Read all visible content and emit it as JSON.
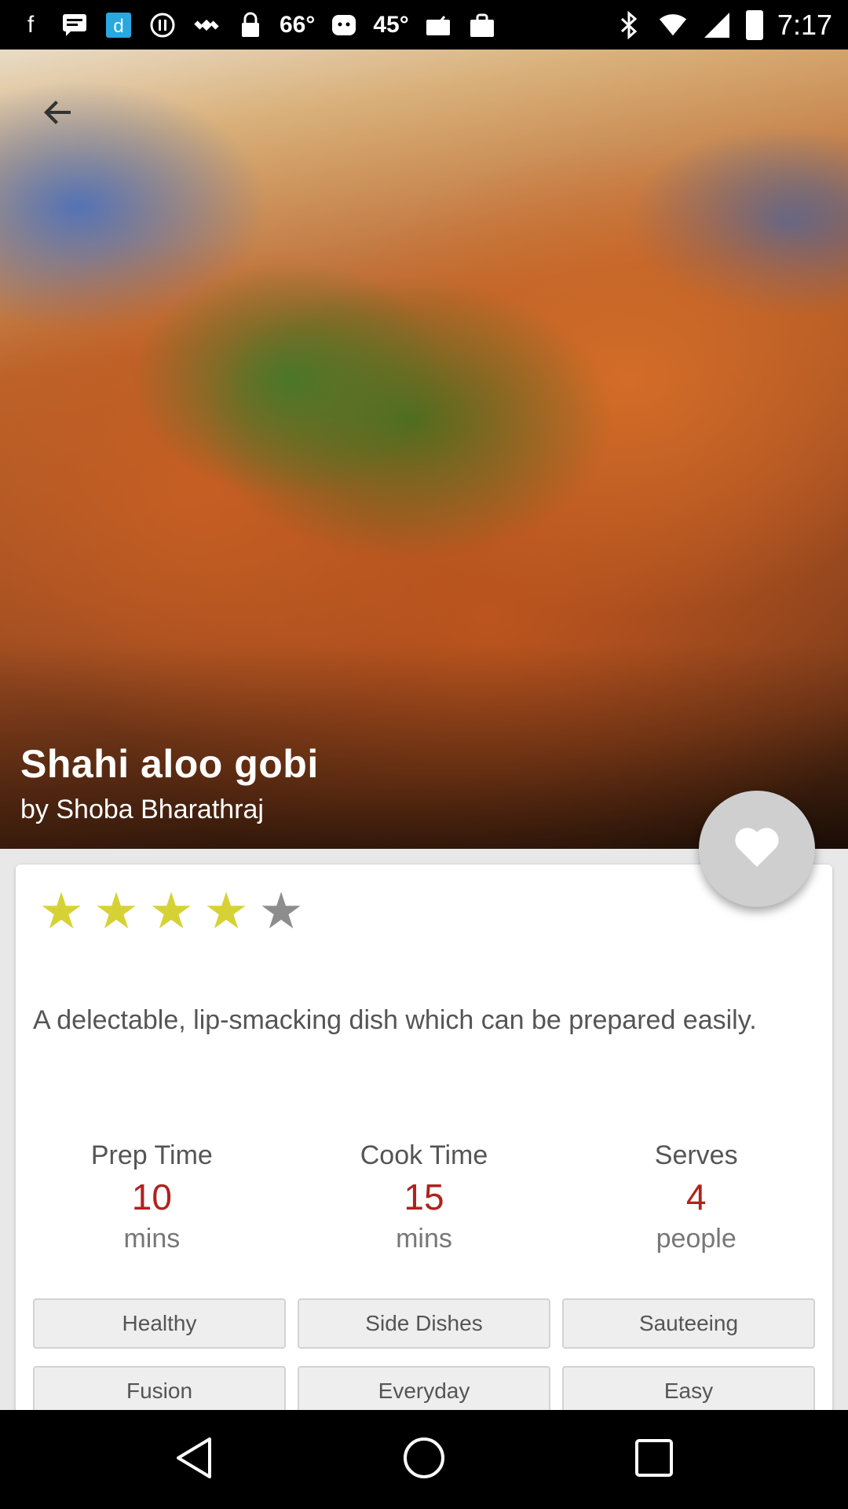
{
  "status_bar": {
    "temps": [
      "66°",
      "45°"
    ],
    "time": "7:17"
  },
  "recipe": {
    "title": "Shahi aloo gobi",
    "author": "by Shoba Bharathraj",
    "rating": 4,
    "rating_max": 5,
    "description": "A delectable, lip-smacking dish which can be prepared easily.",
    "stats": [
      {
        "label": "Prep Time",
        "value": "10",
        "unit": "mins"
      },
      {
        "label": "Cook Time",
        "value": "15",
        "unit": "mins"
      },
      {
        "label": "Serves",
        "value": "4",
        "unit": "people"
      }
    ],
    "tags": [
      "Healthy",
      "Side Dishes",
      "Sauteeing",
      "Fusion",
      "Everyday",
      "Easy"
    ]
  },
  "icons": {
    "back": "arrow-left-icon",
    "favorite": "heart-icon",
    "nav_back": "triangle-back-icon",
    "nav_home": "circle-home-icon",
    "nav_recents": "square-recents-icon"
  },
  "colors": {
    "accent_value": "#b0221f",
    "star_on": "#d6d236",
    "star_off": "#8d8d8d",
    "fab": "#cfcfcf"
  }
}
